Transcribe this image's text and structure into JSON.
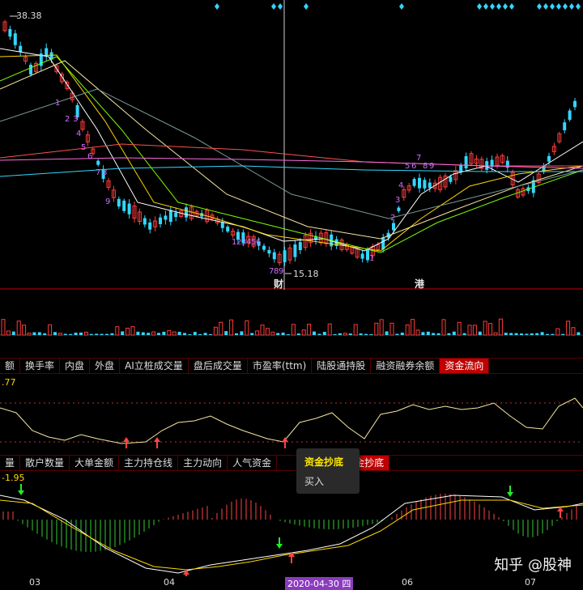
{
  "price_panel": {
    "high_label": "38.38",
    "low_label": "15.18",
    "markers": [
      "财",
      "港"
    ],
    "seq_labels_left": [
      "1",
      "2",
      "3",
      "4",
      "5",
      "6",
      "7",
      "8",
      "9"
    ],
    "seq_labels_mid": [
      "1",
      "2",
      "3",
      "4",
      "5",
      "6",
      "7",
      "8",
      "9"
    ],
    "seq_labels_right": [
      "1",
      "2",
      "3",
      "4",
      "5",
      "6",
      "7",
      "8",
      "9"
    ]
  },
  "tabs_row_1": [
    {
      "label": "额"
    },
    {
      "label": "换手率"
    },
    {
      "label": "内盘"
    },
    {
      "label": "外盘"
    },
    {
      "label": "AI立桩成交量"
    },
    {
      "label": "盘后成交量"
    },
    {
      "label": "市盈率(ttm)"
    },
    {
      "label": "陆股通持股"
    },
    {
      "label": "融资融券余额"
    },
    {
      "label": "资金流向",
      "active": true
    }
  ],
  "indicator1": {
    "value_label": ".77"
  },
  "tabs_row_2": [
    {
      "label": "量"
    },
    {
      "label": "散户数量"
    },
    {
      "label": "大单金额"
    },
    {
      "label": "主力持仓线"
    },
    {
      "label": "主力动向"
    },
    {
      "label": "人气资金"
    },
    {
      "label": "资金抄底",
      "active": true
    }
  ],
  "indicator2": {
    "value_label": "-1.95"
  },
  "tooltip": {
    "title": "资金抄底",
    "body": "买入"
  },
  "time_axis": {
    "labels": [
      "03",
      "04",
      "2020-04-30 四",
      "06",
      "07"
    ]
  },
  "watermark": "知乎 @股神",
  "colors": {
    "up": "#ff3b3b",
    "down": "#33d6ff",
    "accent_tab": "#c00000",
    "tooltip_title": "#ffe600",
    "seq_labels": "#d06bff"
  }
}
